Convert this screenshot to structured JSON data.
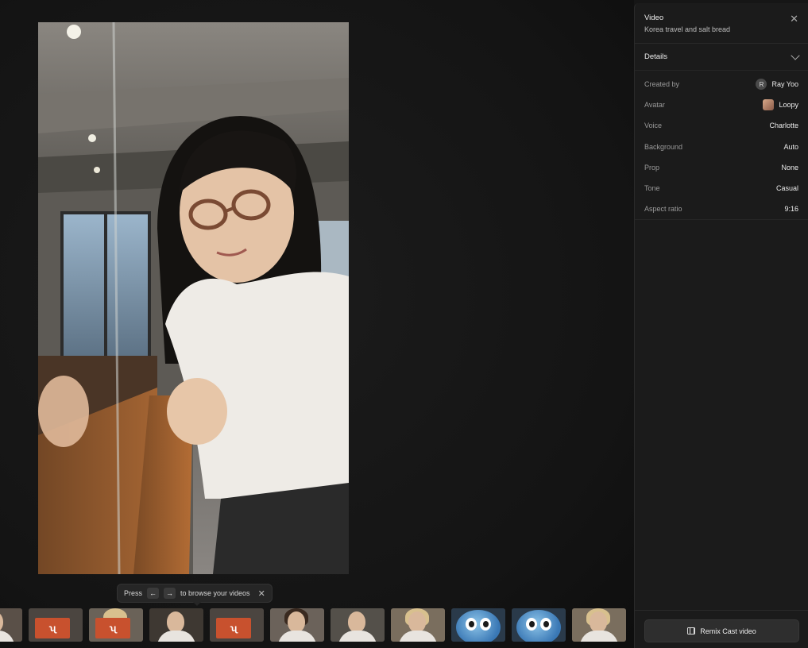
{
  "panel": {
    "title": "Video",
    "subtitle": "Korea travel and salt bread",
    "details_label": "Details",
    "properties": [
      {
        "key": "Created by",
        "value": "Ray Yoo",
        "badge": "R"
      },
      {
        "key": "Avatar",
        "value": "Loopy"
      },
      {
        "key": "Voice",
        "value": "Charlotte"
      },
      {
        "key": "Background",
        "value": "Auto"
      },
      {
        "key": "Prop",
        "value": "None"
      },
      {
        "key": "Tone",
        "value": "Casual"
      },
      {
        "key": "Aspect ratio",
        "value": "9:16"
      }
    ],
    "remix_label": "Remix Cast video"
  },
  "hint": {
    "press": "Press",
    "key_left": "←",
    "key_right": "→",
    "text": "to browse your videos",
    "close": "✕"
  },
  "icons": {
    "close": "close-icon",
    "chevron": "chevron-down-icon",
    "film": "film-icon",
    "arrow_left": "arrow-left-icon",
    "arrow_right": "arrow-right-icon"
  },
  "colors": {
    "background": "#161616",
    "panel": "#1b1b1b",
    "thumbnail_card": "#c8512e",
    "bot_blue": "#3a78b5"
  },
  "filmstrip": {
    "thumbnails": [
      {
        "kind": "person"
      },
      {
        "kind": "card",
        "glyph": "ʯ"
      },
      {
        "kind": "card-blonde",
        "glyph": "ʯ"
      },
      {
        "kind": "person-dark"
      },
      {
        "kind": "card",
        "glyph": "ʯ"
      },
      {
        "kind": "person-woman"
      },
      {
        "kind": "person-man"
      },
      {
        "kind": "person-blonde"
      },
      {
        "kind": "bot"
      },
      {
        "kind": "bot"
      },
      {
        "kind": "person-blonde"
      }
    ]
  }
}
